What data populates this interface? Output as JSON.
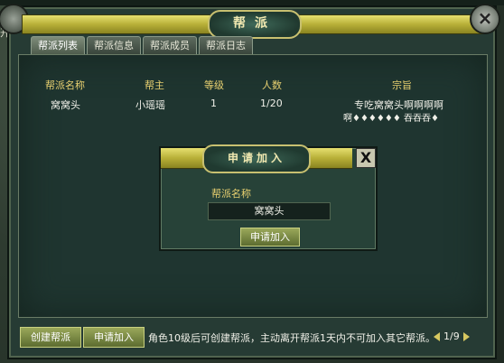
{
  "left_side_text": "开",
  "window": {
    "title": "帮派",
    "tabs": [
      "帮派列表",
      "帮派信息",
      "帮派成员",
      "帮派日志"
    ],
    "active_tab": 0,
    "table": {
      "headers": [
        "帮派名称",
        "帮主",
        "等级",
        "人数",
        "宗旨"
      ],
      "rows": [
        {
          "name": "窝窝头",
          "leader": "小瑶瑶",
          "level": "1",
          "members": "1/20",
          "purpose_line1": "专吃窝窝头啊啊啊啊",
          "purpose_line2": "啊♦♦♦♦♦♦ 吞吞吞♦"
        }
      ]
    },
    "bottom": {
      "create_button": "创建帮派",
      "apply_button": "申请加入",
      "notice": "角色10级后可创建帮派，主动离开帮派1天内不可加入其它帮派。",
      "page_indicator": "1/9"
    }
  },
  "dialog": {
    "title": "申请加入",
    "field_label": "帮派名称",
    "field_value": "窝窝头",
    "submit_button": "申请加入",
    "close_label": "X"
  },
  "colors": {
    "gold": "#e8d070",
    "panel": "#1f3530",
    "title_bar": "#b8b038"
  }
}
